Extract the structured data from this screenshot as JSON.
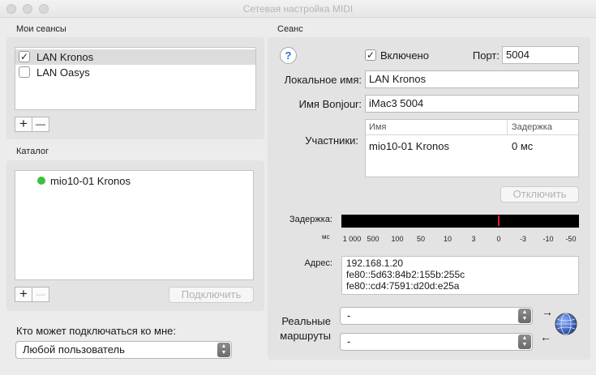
{
  "window": {
    "title": "Сетевая настройка MIDI"
  },
  "my_sessions": {
    "label": "Мои сеансы",
    "items": [
      {
        "label": "LAN Kronos",
        "checked": true,
        "selected": true
      },
      {
        "label": "LAN Oasys",
        "checked": false,
        "selected": false
      }
    ],
    "add_label": "+",
    "remove_label": "—"
  },
  "directory": {
    "label": "Каталог",
    "items": [
      {
        "label": "mio10-01 Kronos",
        "status_color": "#3dbf44"
      }
    ],
    "add_label": "+",
    "remove_label": "—",
    "connect_label": "Подключить"
  },
  "who_can_connect": {
    "label": "Кто может подключаться ко мне:",
    "value": "Любой пользователь"
  },
  "session": {
    "label": "Сеанс",
    "help_label": "?",
    "enabled_label": "Включено",
    "enabled": true,
    "port_label": "Порт:",
    "port_value": "5004",
    "local_name_label": "Локальное имя:",
    "local_name_value": "LAN Kronos",
    "bonjour_label": "Имя Bonjour:",
    "bonjour_value": "iMac3 5004",
    "participants_label": "Участники:",
    "participants_headers": {
      "name": "Имя",
      "latency": "Задержка"
    },
    "participants": [
      {
        "name": "mio10-01 Kronos",
        "latency": "0 мс"
      }
    ],
    "disconnect_label": "Отключить",
    "latency_label": "Задержка:",
    "latency_unit": "мс",
    "latency_ticks": [
      "1 000",
      "500",
      "100",
      "50",
      "10",
      "3",
      "0",
      "-3",
      "-10",
      "-50"
    ],
    "latency_marker_color": "#e0202a",
    "address_label": "Адрес:",
    "addresses": [
      "192.168.1.20",
      "fe80::5d63:84b2:155b:255c",
      "fe80::cd4:7591:d20d:e25a"
    ],
    "routes_label_1": "Реальные",
    "routes_label_2": "маршруты",
    "route_in_value": "-",
    "route_out_value": "-"
  }
}
